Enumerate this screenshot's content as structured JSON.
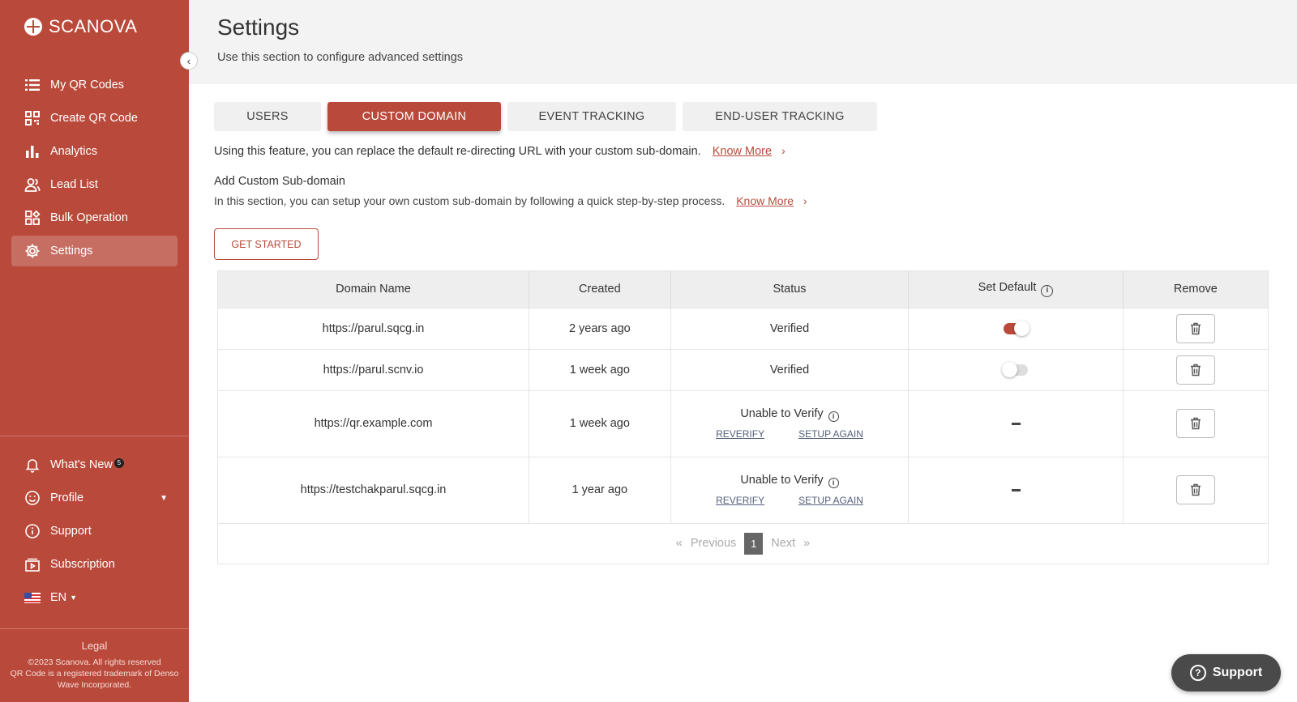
{
  "brand": {
    "name": "SCANOVA"
  },
  "sidebar": {
    "items": [
      {
        "label": "My QR Codes",
        "icon": "list-icon"
      },
      {
        "label": "Create QR Code",
        "icon": "qr-code-icon"
      },
      {
        "label": "Analytics",
        "icon": "bar-chart-icon"
      },
      {
        "label": "Lead List",
        "icon": "users-icon"
      },
      {
        "label": "Bulk Operation",
        "icon": "bulk-icon"
      },
      {
        "label": "Settings",
        "icon": "gear-icon",
        "active": true
      }
    ],
    "bottom": {
      "whats_new": "What's New",
      "whats_new_badge": "5",
      "profile": "Profile",
      "support": "Support",
      "subscription": "Subscription",
      "language": "EN"
    },
    "legal": "Legal",
    "copyright": "©2023 Scanova. All rights reserved",
    "trademark": "QR Code is a registered trademark of Denso Wave Incorporated."
  },
  "header": {
    "title": "Settings",
    "subtitle": "Use this section to configure advanced settings"
  },
  "tabs": [
    {
      "label": "USERS"
    },
    {
      "label": "CUSTOM DOMAIN",
      "active": true
    },
    {
      "label": "EVENT TRACKING"
    },
    {
      "label": "END-USER TRACKING"
    }
  ],
  "intro": {
    "text": "Using this feature, you can replace the default re-directing URL with your custom sub-domain.",
    "link": "Know More"
  },
  "sub_section": {
    "heading": "Add Custom Sub-domain",
    "text": "In this section, you can setup your own custom sub-domain by following a quick step-by-step process.",
    "link": "Know More"
  },
  "get_started_label": "GET STARTED",
  "table": {
    "headers": [
      "Domain Name",
      "Created",
      "Status",
      "Set Default",
      "Remove"
    ],
    "rows": [
      {
        "domain": "https://parul.sqcg.in",
        "created": "2 years ago",
        "status": "Verified",
        "default": "on"
      },
      {
        "domain": "https://parul.scnv.io",
        "created": "1 week ago",
        "status": "Verified",
        "default": "off"
      },
      {
        "domain": "https://qr.example.com",
        "created": "1 week ago",
        "status": "Unable to Verify",
        "reverify": "REVERIFY",
        "setup_again": "SETUP AGAIN"
      },
      {
        "domain": "https://testchakparul.sqcg.in",
        "created": "1 year ago",
        "status": "Unable to Verify",
        "reverify": "REVERIFY",
        "setup_again": "SETUP AGAIN"
      }
    ]
  },
  "pagination": {
    "prev_symbol": "«",
    "previous": "Previous",
    "current": "1",
    "next": "Next",
    "next_symbol": "»"
  },
  "support_button": "Support",
  "colors": {
    "brand": "#b94a3b",
    "header_bg": "#f3f3f3"
  }
}
